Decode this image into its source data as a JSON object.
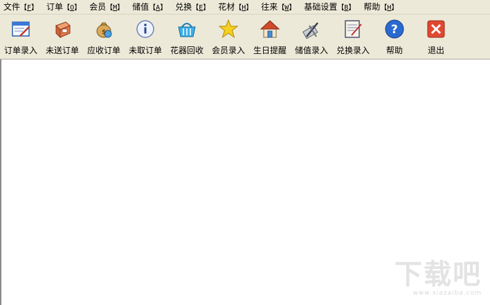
{
  "menu": [
    {
      "label": "文件",
      "key": "F"
    },
    {
      "label": "订单",
      "key": "O"
    },
    {
      "label": "会员",
      "key": "M"
    },
    {
      "label": "储值",
      "key": "A"
    },
    {
      "label": "兑换",
      "key": "E"
    },
    {
      "label": "花材",
      "key": "H"
    },
    {
      "label": "往来",
      "key": "W"
    },
    {
      "label": "基础设置",
      "key": "B"
    },
    {
      "label": "帮助",
      "key": "H"
    }
  ],
  "toolbar": {
    "order_entry": "订单录入",
    "unsent_orders": "未送订单",
    "receivable_orders": "应收订单",
    "unpicked_orders": "未取订单",
    "vase_recycle": "花器回收",
    "member_entry": "会员录入",
    "birthday_reminder": "生日提醒",
    "stored_value_entry": "储值录入",
    "exchange_entry": "兑换录入",
    "help": "帮助",
    "exit": "退出"
  },
  "watermark": {
    "main": "下载吧",
    "sub": "www.xiazaiba.com"
  }
}
